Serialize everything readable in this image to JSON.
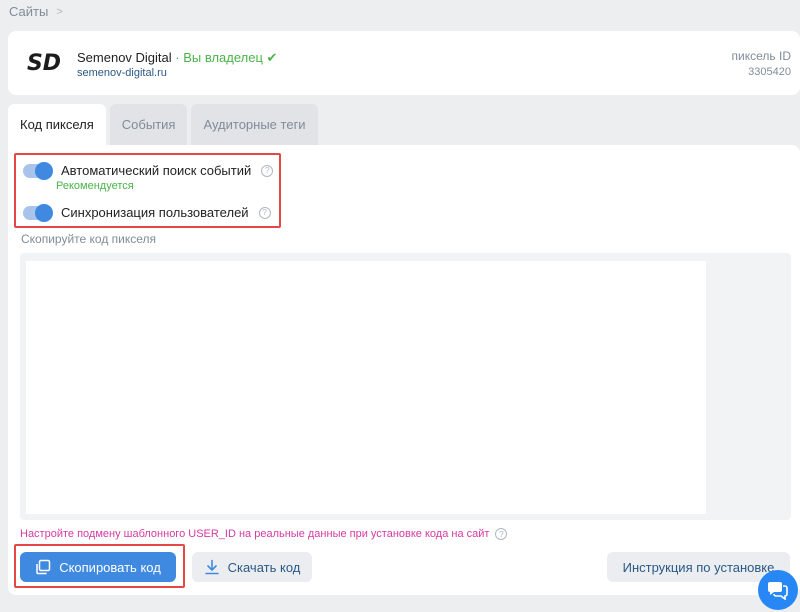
{
  "breadcrumb": {
    "label": "Сайты",
    "chevron": "chevron-right-icon"
  },
  "site": {
    "logo_text": "SD",
    "name": "Semenov Digital",
    "owner_status": "· Вы владелец",
    "verified_icon": "check-icon",
    "url": "semenov-digital.ru",
    "pixel_label": "пиксель ID",
    "pixel_id": "3305420"
  },
  "tabs": [
    {
      "label": "Код пикселя",
      "active": true
    },
    {
      "label": "События",
      "active": false
    },
    {
      "label": "Аудиторные теги",
      "active": false
    }
  ],
  "settings": {
    "auto_search": {
      "label": "Автоматический поиск событий",
      "hint": "Рекомендуется",
      "enabled": true
    },
    "user_sync": {
      "label": "Синхронизация пользователей",
      "enabled": true
    },
    "help_glyph": "?"
  },
  "code": {
    "caption": "Скопируйте код пикселя"
  },
  "notice": {
    "text": "Настройте подмену шаблонного USER_ID на реальные данные при установке кода на сайт"
  },
  "actions": {
    "copy_label": "Скопировать код",
    "download_label": "Скачать код",
    "instructions_label": "Инструкция по установке"
  },
  "colors": {
    "accent": "#3f8ae0",
    "highlight": "#e64646",
    "success": "#4bb34b",
    "notice": "#d63aa3"
  }
}
